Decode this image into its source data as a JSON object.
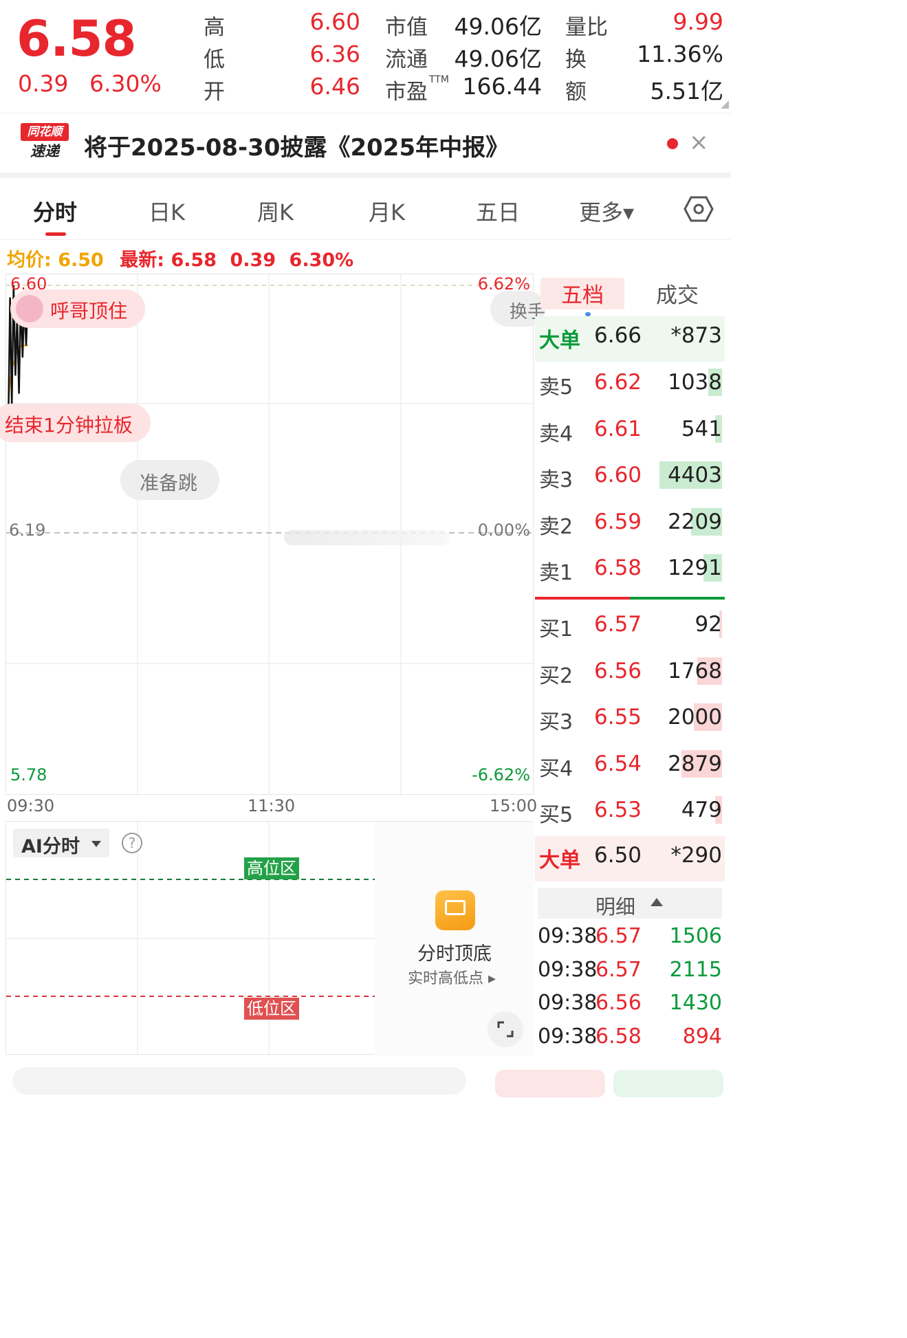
{
  "quote": {
    "price": "6.58",
    "change": "0.39",
    "change_pct": "6.30%",
    "rows": [
      {
        "l1": "高",
        "v1": "6.60",
        "l2": "市值",
        "v2": "49.06亿",
        "l3": "量比",
        "v3": "9.99"
      },
      {
        "l1": "低",
        "v1": "6.36",
        "l2": "流通",
        "v2": "49.06亿",
        "l3": "换",
        "v3": "11.36%"
      },
      {
        "l1": "开",
        "v1": "6.46",
        "l2": "市盈",
        "v2": "166.44",
        "l3": "额",
        "v3": "5.51亿"
      }
    ],
    "ttm": "TTM"
  },
  "banner": {
    "logo_top": "同花顺",
    "logo_bottom": "速递",
    "text": "将于2025-08-30披露《2025年中报》",
    "close": "×"
  },
  "tabs": [
    "分时",
    "日K",
    "周K",
    "月K",
    "五日",
    "更多▾"
  ],
  "summary": {
    "avg_label": "均价:",
    "avg_value": "6.50",
    "latest_label": "最新:",
    "latest_value": "6.58",
    "change": "0.39",
    "change_pct": "6.30%"
  },
  "chart": {
    "y_top": "6.60",
    "y_mid": "6.19",
    "y_bot": "5.78",
    "pct_top": "6.62%",
    "pct_mid": "0.00%",
    "pct_bot": "-6.62%",
    "times": [
      "09:30",
      "11:30",
      "15:00"
    ],
    "tag_hot": "呼哥顶住",
    "tag_close": "结束1分钟拉板",
    "tag_ready": "准备跳",
    "tag_switch": "换手",
    "price_series": [
      6.36,
      6.58,
      6.4,
      6.6,
      6.45,
      6.55,
      6.42,
      6.58,
      6.48,
      6.57,
      6.5,
      6.58
    ],
    "avg_series": [
      6.4,
      6.44,
      6.46,
      6.47,
      6.48,
      6.49,
      6.49,
      6.5,
      6.5,
      6.5,
      6.5,
      6.5
    ],
    "colors": {
      "up": "#e8262d",
      "down": "#0a9a3a",
      "avg": "#f0a500"
    }
  },
  "orderbook": {
    "tab_active": "五档",
    "tab_other": "成交",
    "big_sell": {
      "label": "大单",
      "price": "6.66",
      "vol": "*873"
    },
    "asks": [
      {
        "label": "卖5",
        "price": "6.62",
        "vol": "1038",
        "ratio": 0.14
      },
      {
        "label": "卖4",
        "price": "6.61",
        "vol": "541",
        "ratio": 0.07
      },
      {
        "label": "卖3",
        "price": "6.60",
        "vol": "4403",
        "ratio": 0.65
      },
      {
        "label": "卖2",
        "price": "6.59",
        "vol": "2209",
        "ratio": 0.32
      },
      {
        "label": "卖1",
        "price": "6.58",
        "vol": "1291",
        "ratio": 0.19
      }
    ],
    "bids": [
      {
        "label": "买1",
        "price": "6.57",
        "vol": "92",
        "ratio": 0.02
      },
      {
        "label": "买2",
        "price": "6.56",
        "vol": "1768",
        "ratio": 0.26
      },
      {
        "label": "买3",
        "price": "6.55",
        "vol": "2000",
        "ratio": 0.29
      },
      {
        "label": "买4",
        "price": "6.54",
        "vol": "2879",
        "ratio": 0.42
      },
      {
        "label": "买5",
        "price": "6.53",
        "vol": "479",
        "ratio": 0.07
      }
    ],
    "big_buy": {
      "label": "大单",
      "price": "6.50",
      "vol": "*290"
    },
    "detail_label": "明细",
    "trades": [
      {
        "time": "09:38",
        "price": "6.57",
        "vol": "1506",
        "dir": "down"
      },
      {
        "time": "09:38",
        "price": "6.57",
        "vol": "2115",
        "dir": "down"
      },
      {
        "time": "09:38",
        "price": "6.56",
        "vol": "1430",
        "dir": "down"
      },
      {
        "time": "09:38",
        "price": "6.58",
        "vol": "894",
        "dir": "up"
      }
    ]
  },
  "ai": {
    "selector": "AI分时",
    "help": "?",
    "high_zone": "高位区",
    "low_zone": "低位区",
    "feature_title": "分时顶底",
    "feature_sub": "实时高低点"
  }
}
